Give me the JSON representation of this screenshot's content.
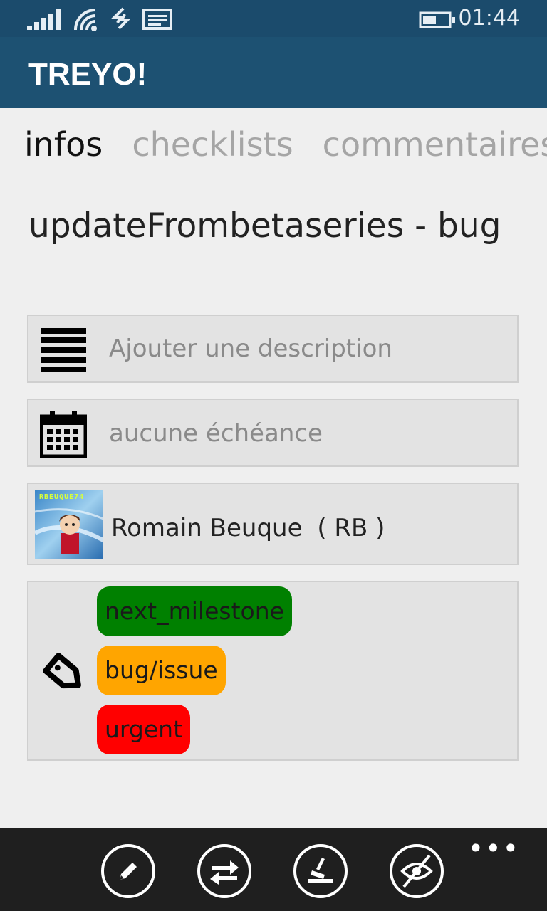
{
  "status_bar": {
    "time": "01:44",
    "icons": [
      "signal-icon",
      "wifi-icon",
      "data-sync-icon",
      "message-icon",
      "battery-icon"
    ]
  },
  "app": {
    "title": "TREYO!",
    "header_color": "#1d5172"
  },
  "tabs": [
    {
      "label": "infos",
      "active": true
    },
    {
      "label": "checklists",
      "active": false
    },
    {
      "label": "commentaires",
      "active": false
    }
  ],
  "card": {
    "title": "updateFrombetaseries - bug",
    "description_placeholder": "Ajouter une description",
    "due_date": "aucune échéance",
    "member": {
      "name": "Romain Beuque",
      "initials": "( RB )",
      "avatar_caption": "RBEUQUE74"
    },
    "labels": [
      {
        "name": "next_milestone",
        "color": "#008000"
      },
      {
        "name": "bug/issue",
        "color": "#ffa500"
      },
      {
        "name": "urgent",
        "color": "#ff0000"
      }
    ]
  },
  "app_bar": {
    "buttons": [
      "edit-icon",
      "swap-icon",
      "archive-icon",
      "unwatch-icon"
    ],
    "more": "•••"
  }
}
